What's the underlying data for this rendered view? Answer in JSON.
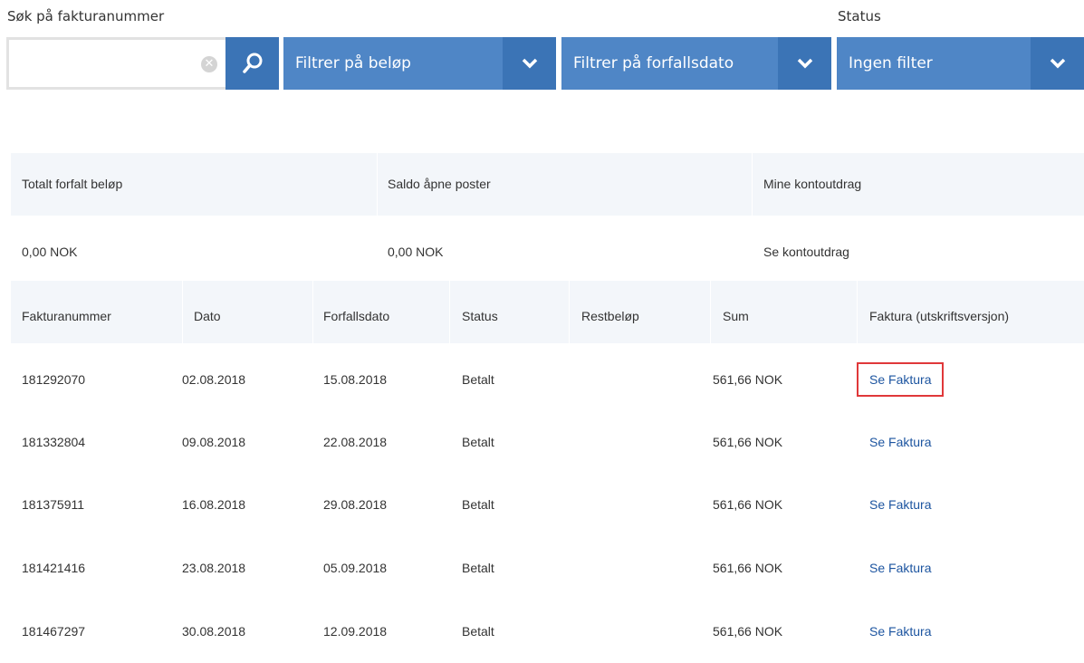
{
  "filters": {
    "search_label": "Søk på fakturanummer",
    "search_value": "",
    "search_placeholder": "",
    "amount_filter": "Filtrer på beløp",
    "due_date_filter": "Filtrer på forfallsdato",
    "status_label": "Status",
    "status_filter": "Ingen filter"
  },
  "summary": {
    "headers": [
      "Totalt forfalt beløp",
      "Saldo åpne poster",
      "Mine kontoutdrag"
    ],
    "total_due": "0,00 NOK",
    "open_balance": "0,00 NOK",
    "statements_link": "Se kontoutdrag"
  },
  "table": {
    "columns": [
      "Fakturanummer",
      "Dato",
      "Forfallsdato",
      "Status",
      "Restbeløp",
      "Sum",
      "Faktura (utskriftsversjon)"
    ],
    "rows": [
      {
        "invoice": "181292070",
        "date": "02.08.2018",
        "due": "15.08.2018",
        "status": "Betalt",
        "remaining": "",
        "sum": "561,66 NOK",
        "link": "Se Faktura"
      },
      {
        "invoice": "181332804",
        "date": "09.08.2018",
        "due": "22.08.2018",
        "status": "Betalt",
        "remaining": "",
        "sum": "561,66 NOK",
        "link": "Se Faktura"
      },
      {
        "invoice": "181375911",
        "date": "16.08.2018",
        "due": "29.08.2018",
        "status": "Betalt",
        "remaining": "",
        "sum": "561,66 NOK",
        "link": "Se Faktura"
      },
      {
        "invoice": "181421416",
        "date": "23.08.2018",
        "due": "05.09.2018",
        "status": "Betalt",
        "remaining": "",
        "sum": "561,66 NOK",
        "link": "Se Faktura"
      },
      {
        "invoice": "181467297",
        "date": "30.08.2018",
        "due": "12.09.2018",
        "status": "Betalt",
        "remaining": "",
        "sum": "561,66 NOK",
        "link": "Se Faktura"
      }
    ]
  },
  "colors": {
    "accent": "#4f86c6",
    "accent_dark": "#3b74b6",
    "link": "#1d55a0",
    "highlight": "#e0383a",
    "header_bg": "#f3f6fa"
  }
}
